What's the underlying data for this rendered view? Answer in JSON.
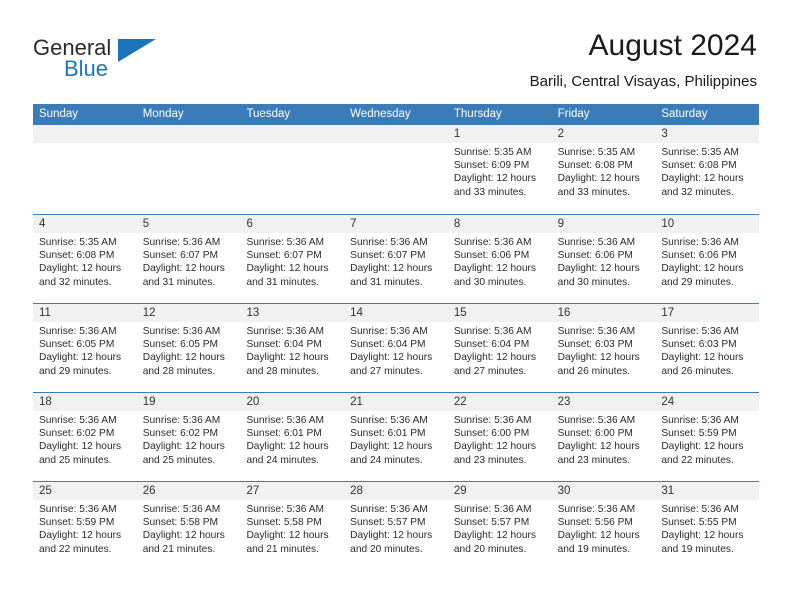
{
  "brand": {
    "name_line1": "General",
    "name_line2": "Blue",
    "accent_color": "#1c75bc"
  },
  "header": {
    "title": "August 2024",
    "subtitle": "Barili, Central Visayas, Philippines"
  },
  "theme": {
    "header_row_bg": "#3b7cb8",
    "day_band_bg": "#f1f1f1",
    "text_color": "#2b2b2b"
  },
  "weekday_headers": [
    "Sunday",
    "Monday",
    "Tuesday",
    "Wednesday",
    "Thursday",
    "Friday",
    "Saturday"
  ],
  "weeks": [
    [
      {
        "day": "",
        "sunrise": "",
        "sunset": "",
        "daylight_line1": "",
        "daylight_line2": ""
      },
      {
        "day": "",
        "sunrise": "",
        "sunset": "",
        "daylight_line1": "",
        "daylight_line2": ""
      },
      {
        "day": "",
        "sunrise": "",
        "sunset": "",
        "daylight_line1": "",
        "daylight_line2": ""
      },
      {
        "day": "",
        "sunrise": "",
        "sunset": "",
        "daylight_line1": "",
        "daylight_line2": ""
      },
      {
        "day": "1",
        "sunrise": "Sunrise: 5:35 AM",
        "sunset": "Sunset: 6:09 PM",
        "daylight_line1": "Daylight: 12 hours",
        "daylight_line2": "and 33 minutes."
      },
      {
        "day": "2",
        "sunrise": "Sunrise: 5:35 AM",
        "sunset": "Sunset: 6:08 PM",
        "daylight_line1": "Daylight: 12 hours",
        "daylight_line2": "and 33 minutes."
      },
      {
        "day": "3",
        "sunrise": "Sunrise: 5:35 AM",
        "sunset": "Sunset: 6:08 PM",
        "daylight_line1": "Daylight: 12 hours",
        "daylight_line2": "and 32 minutes."
      }
    ],
    [
      {
        "day": "4",
        "sunrise": "Sunrise: 5:35 AM",
        "sunset": "Sunset: 6:08 PM",
        "daylight_line1": "Daylight: 12 hours",
        "daylight_line2": "and 32 minutes."
      },
      {
        "day": "5",
        "sunrise": "Sunrise: 5:36 AM",
        "sunset": "Sunset: 6:07 PM",
        "daylight_line1": "Daylight: 12 hours",
        "daylight_line2": "and 31 minutes."
      },
      {
        "day": "6",
        "sunrise": "Sunrise: 5:36 AM",
        "sunset": "Sunset: 6:07 PM",
        "daylight_line1": "Daylight: 12 hours",
        "daylight_line2": "and 31 minutes."
      },
      {
        "day": "7",
        "sunrise": "Sunrise: 5:36 AM",
        "sunset": "Sunset: 6:07 PM",
        "daylight_line1": "Daylight: 12 hours",
        "daylight_line2": "and 31 minutes."
      },
      {
        "day": "8",
        "sunrise": "Sunrise: 5:36 AM",
        "sunset": "Sunset: 6:06 PM",
        "daylight_line1": "Daylight: 12 hours",
        "daylight_line2": "and 30 minutes."
      },
      {
        "day": "9",
        "sunrise": "Sunrise: 5:36 AM",
        "sunset": "Sunset: 6:06 PM",
        "daylight_line1": "Daylight: 12 hours",
        "daylight_line2": "and 30 minutes."
      },
      {
        "day": "10",
        "sunrise": "Sunrise: 5:36 AM",
        "sunset": "Sunset: 6:06 PM",
        "daylight_line1": "Daylight: 12 hours",
        "daylight_line2": "and 29 minutes."
      }
    ],
    [
      {
        "day": "11",
        "sunrise": "Sunrise: 5:36 AM",
        "sunset": "Sunset: 6:05 PM",
        "daylight_line1": "Daylight: 12 hours",
        "daylight_line2": "and 29 minutes."
      },
      {
        "day": "12",
        "sunrise": "Sunrise: 5:36 AM",
        "sunset": "Sunset: 6:05 PM",
        "daylight_line1": "Daylight: 12 hours",
        "daylight_line2": "and 28 minutes."
      },
      {
        "day": "13",
        "sunrise": "Sunrise: 5:36 AM",
        "sunset": "Sunset: 6:04 PM",
        "daylight_line1": "Daylight: 12 hours",
        "daylight_line2": "and 28 minutes."
      },
      {
        "day": "14",
        "sunrise": "Sunrise: 5:36 AM",
        "sunset": "Sunset: 6:04 PM",
        "daylight_line1": "Daylight: 12 hours",
        "daylight_line2": "and 27 minutes."
      },
      {
        "day": "15",
        "sunrise": "Sunrise: 5:36 AM",
        "sunset": "Sunset: 6:04 PM",
        "daylight_line1": "Daylight: 12 hours",
        "daylight_line2": "and 27 minutes."
      },
      {
        "day": "16",
        "sunrise": "Sunrise: 5:36 AM",
        "sunset": "Sunset: 6:03 PM",
        "daylight_line1": "Daylight: 12 hours",
        "daylight_line2": "and 26 minutes."
      },
      {
        "day": "17",
        "sunrise": "Sunrise: 5:36 AM",
        "sunset": "Sunset: 6:03 PM",
        "daylight_line1": "Daylight: 12 hours",
        "daylight_line2": "and 26 minutes."
      }
    ],
    [
      {
        "day": "18",
        "sunrise": "Sunrise: 5:36 AM",
        "sunset": "Sunset: 6:02 PM",
        "daylight_line1": "Daylight: 12 hours",
        "daylight_line2": "and 25 minutes."
      },
      {
        "day": "19",
        "sunrise": "Sunrise: 5:36 AM",
        "sunset": "Sunset: 6:02 PM",
        "daylight_line1": "Daylight: 12 hours",
        "daylight_line2": "and 25 minutes."
      },
      {
        "day": "20",
        "sunrise": "Sunrise: 5:36 AM",
        "sunset": "Sunset: 6:01 PM",
        "daylight_line1": "Daylight: 12 hours",
        "daylight_line2": "and 24 minutes."
      },
      {
        "day": "21",
        "sunrise": "Sunrise: 5:36 AM",
        "sunset": "Sunset: 6:01 PM",
        "daylight_line1": "Daylight: 12 hours",
        "daylight_line2": "and 24 minutes."
      },
      {
        "day": "22",
        "sunrise": "Sunrise: 5:36 AM",
        "sunset": "Sunset: 6:00 PM",
        "daylight_line1": "Daylight: 12 hours",
        "daylight_line2": "and 23 minutes."
      },
      {
        "day": "23",
        "sunrise": "Sunrise: 5:36 AM",
        "sunset": "Sunset: 6:00 PM",
        "daylight_line1": "Daylight: 12 hours",
        "daylight_line2": "and 23 minutes."
      },
      {
        "day": "24",
        "sunrise": "Sunrise: 5:36 AM",
        "sunset": "Sunset: 5:59 PM",
        "daylight_line1": "Daylight: 12 hours",
        "daylight_line2": "and 22 minutes."
      }
    ],
    [
      {
        "day": "25",
        "sunrise": "Sunrise: 5:36 AM",
        "sunset": "Sunset: 5:59 PM",
        "daylight_line1": "Daylight: 12 hours",
        "daylight_line2": "and 22 minutes."
      },
      {
        "day": "26",
        "sunrise": "Sunrise: 5:36 AM",
        "sunset": "Sunset: 5:58 PM",
        "daylight_line1": "Daylight: 12 hours",
        "daylight_line2": "and 21 minutes."
      },
      {
        "day": "27",
        "sunrise": "Sunrise: 5:36 AM",
        "sunset": "Sunset: 5:58 PM",
        "daylight_line1": "Daylight: 12 hours",
        "daylight_line2": "and 21 minutes."
      },
      {
        "day": "28",
        "sunrise": "Sunrise: 5:36 AM",
        "sunset": "Sunset: 5:57 PM",
        "daylight_line1": "Daylight: 12 hours",
        "daylight_line2": "and 20 minutes."
      },
      {
        "day": "29",
        "sunrise": "Sunrise: 5:36 AM",
        "sunset": "Sunset: 5:57 PM",
        "daylight_line1": "Daylight: 12 hours",
        "daylight_line2": "and 20 minutes."
      },
      {
        "day": "30",
        "sunrise": "Sunrise: 5:36 AM",
        "sunset": "Sunset: 5:56 PM",
        "daylight_line1": "Daylight: 12 hours",
        "daylight_line2": "and 19 minutes."
      },
      {
        "day": "31",
        "sunrise": "Sunrise: 5:36 AM",
        "sunset": "Sunset: 5:55 PM",
        "daylight_line1": "Daylight: 12 hours",
        "daylight_line2": "and 19 minutes."
      }
    ]
  ]
}
